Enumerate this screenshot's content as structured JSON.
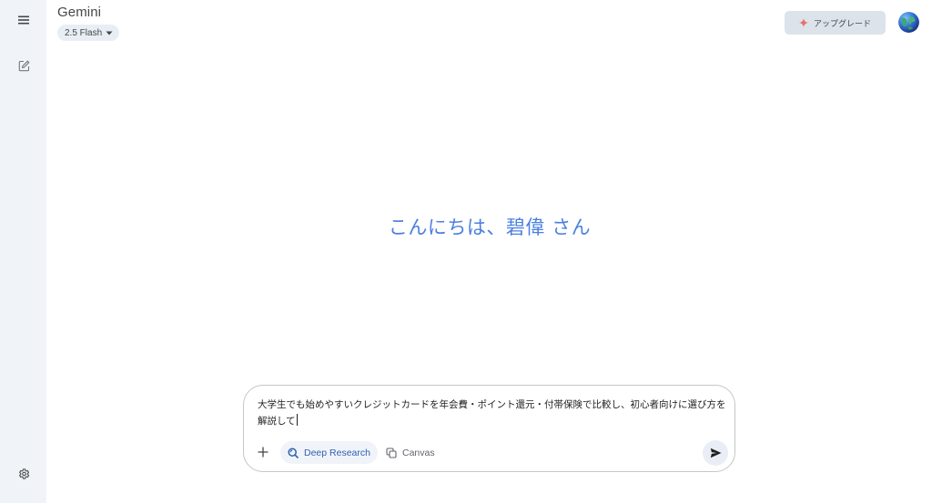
{
  "header": {
    "title": "Gemini",
    "model": "2.5 Flash",
    "upgrade_label": "アップグレード"
  },
  "greeting": "こんにちは、碧偉 さん",
  "prompt": {
    "value": "大学生でも始めやすいクレジットカードを年会費・ポイント還元・付帯保険で比較し、初心者向けに選び方を解説して",
    "tools": {
      "deep_research": "Deep Research",
      "canvas": "Canvas"
    }
  },
  "icons": {
    "menu": "menu-icon",
    "new_chat": "edit-icon",
    "settings": "gear-icon",
    "sparkle": "sparkle-icon",
    "add": "plus-icon",
    "send": "send-icon"
  },
  "colors": {
    "rail": "#f0f4f9",
    "greeting": "#4a7fe0",
    "sparkle": "#e8716b",
    "deep_research": "#2f5fb3"
  }
}
